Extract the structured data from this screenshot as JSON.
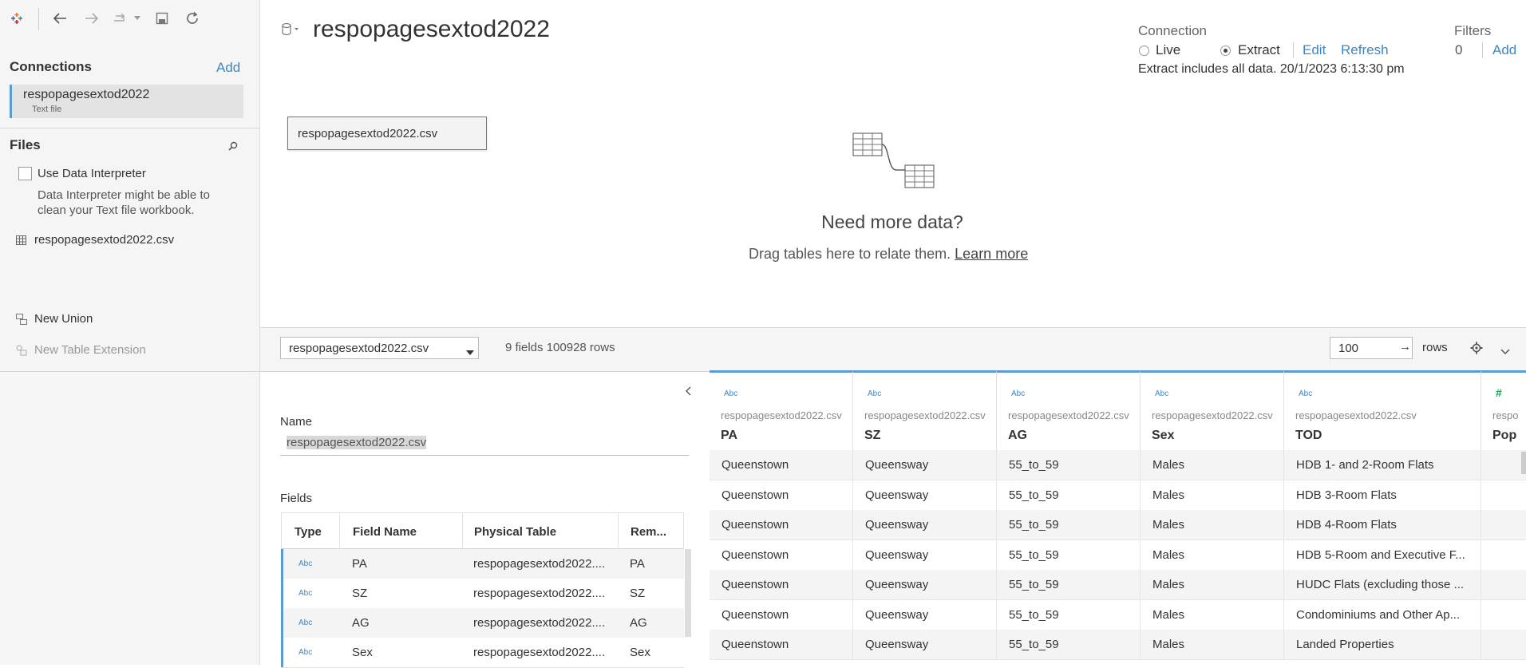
{
  "toolbar": {
    "icons": [
      "tableau-logo-icon",
      "back-icon",
      "forward-icon",
      "redo-icon",
      "dropdown-icon",
      "save-icon",
      "refresh-icon"
    ]
  },
  "sidebar": {
    "connections_title": "Connections",
    "add_label": "Add",
    "connection": {
      "name": "respopagesextod2022",
      "type": "Text file"
    },
    "files_title": "Files",
    "use_interpreter_label": "Use Data Interpreter",
    "interpreter_note_1": "Data Interpreter might be able to",
    "interpreter_note_2": "clean your Text file workbook.",
    "file_item": "respopagesextod2022.csv",
    "new_union": "New Union",
    "new_table_extension": "New Table Extension"
  },
  "header": {
    "datasource_title": "respopagesextod2022",
    "connection_label": "Connection",
    "live_label": "Live",
    "extract_label": "Extract",
    "edit_label": "Edit",
    "refresh_label": "Refresh",
    "extract_info": "Extract includes all data. 20/1/2023 6:13:30 pm",
    "filters_label": "Filters",
    "filters_count": "0",
    "filters_add": "Add",
    "selected_connection": "Extract"
  },
  "canvas": {
    "table_chip": "respopagesextod2022.csv",
    "need_more": "Need more data?",
    "drag_text": "Drag tables here to relate them.",
    "learn_more": "Learn more"
  },
  "lower_bar": {
    "table_select": "respopagesextod2022.csv",
    "summary": "9 fields 100928 rows",
    "rows_value": "100",
    "rows_label": "rows"
  },
  "metadata": {
    "name_label": "Name",
    "name_value": "respopagesextod2022.csv",
    "fields_label": "Fields",
    "headers": {
      "type": "Type",
      "field_name": "Field Name",
      "physical_table": "Physical Table",
      "remote": "Rem..."
    },
    "rows": [
      {
        "type": "Abc",
        "name": "PA",
        "table": "respopagesextod2022....",
        "remote": "PA"
      },
      {
        "type": "Abc",
        "name": "SZ",
        "table": "respopagesextod2022....",
        "remote": "SZ"
      },
      {
        "type": "Abc",
        "name": "AG",
        "table": "respopagesextod2022....",
        "remote": "AG"
      },
      {
        "type": "Abc",
        "name": "Sex",
        "table": "respopagesextod2022....",
        "remote": "Sex"
      }
    ]
  },
  "grid": {
    "columns": [
      {
        "type": "Abc",
        "source": "respopagesextod2022.csv",
        "name": "PA"
      },
      {
        "type": "Abc",
        "source": "respopagesextod2022.csv",
        "name": "SZ"
      },
      {
        "type": "Abc",
        "source": "respopagesextod2022.csv",
        "name": "AG"
      },
      {
        "type": "Abc",
        "source": "respopagesextod2022.csv",
        "name": "Sex"
      },
      {
        "type": "Abc",
        "source": "respopagesextod2022.csv",
        "name": "TOD"
      },
      {
        "type": "#",
        "source": "respo",
        "name": "Pop"
      }
    ],
    "rows": [
      [
        "Queenstown",
        "Queensway",
        "55_to_59",
        "Males",
        "HDB 1- and 2-Room Flats",
        ""
      ],
      [
        "Queenstown",
        "Queensway",
        "55_to_59",
        "Males",
        "HDB 3-Room Flats",
        ""
      ],
      [
        "Queenstown",
        "Queensway",
        "55_to_59",
        "Males",
        "HDB 4-Room Flats",
        ""
      ],
      [
        "Queenstown",
        "Queensway",
        "55_to_59",
        "Males",
        "HDB 5-Room and Executive F...",
        ""
      ],
      [
        "Queenstown",
        "Queensway",
        "55_to_59",
        "Males",
        "HUDC Flats (excluding those ...",
        ""
      ],
      [
        "Queenstown",
        "Queensway",
        "55_to_59",
        "Males",
        "Condominiums and Other Ap...",
        ""
      ],
      [
        "Queenstown",
        "Queensway",
        "55_to_59",
        "Males",
        "Landed Properties",
        ""
      ]
    ]
  },
  "colors": {
    "accent": "#3d87c6",
    "number_type": "#1e9e5a"
  }
}
